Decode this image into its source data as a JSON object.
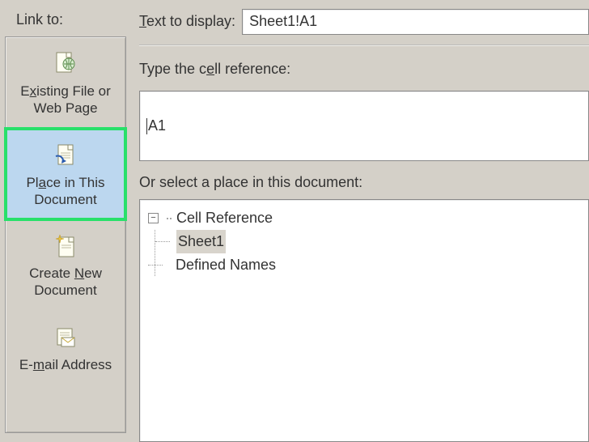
{
  "sidebar": {
    "title": "Link to:",
    "items": [
      {
        "label_pre": "E",
        "mnemonic": "x",
        "label_post": "isting File or Web Page",
        "icon": "file-web-icon"
      },
      {
        "label_pre": "Pl",
        "mnemonic": "a",
        "label_post": "ce in This Document",
        "icon": "place-doc-icon"
      },
      {
        "label_pre": "Create ",
        "mnemonic": "N",
        "label_post": "ew Document",
        "icon": "new-doc-icon"
      },
      {
        "label_pre": "E-",
        "mnemonic": "m",
        "label_post": "ail Address",
        "icon": "email-icon"
      }
    ],
    "selected_index": 1
  },
  "fields": {
    "text_to_display_label_pre": "",
    "text_to_display_mnemonic": "T",
    "text_to_display_label_post": "ext to display:",
    "text_to_display_value": "Sheet1!A1",
    "cell_ref_label_pre": "Type the c",
    "cell_ref_mnemonic": "e",
    "cell_ref_label_post": "ll reference:",
    "cell_ref_value": "A1",
    "place_label": "Or select a place in this document:"
  },
  "tree": {
    "root": {
      "label": "Cell Reference",
      "expanded": true,
      "children": [
        {
          "label": "Sheet1",
          "selected": true
        }
      ]
    },
    "sibling": {
      "label": "Defined Names"
    }
  }
}
